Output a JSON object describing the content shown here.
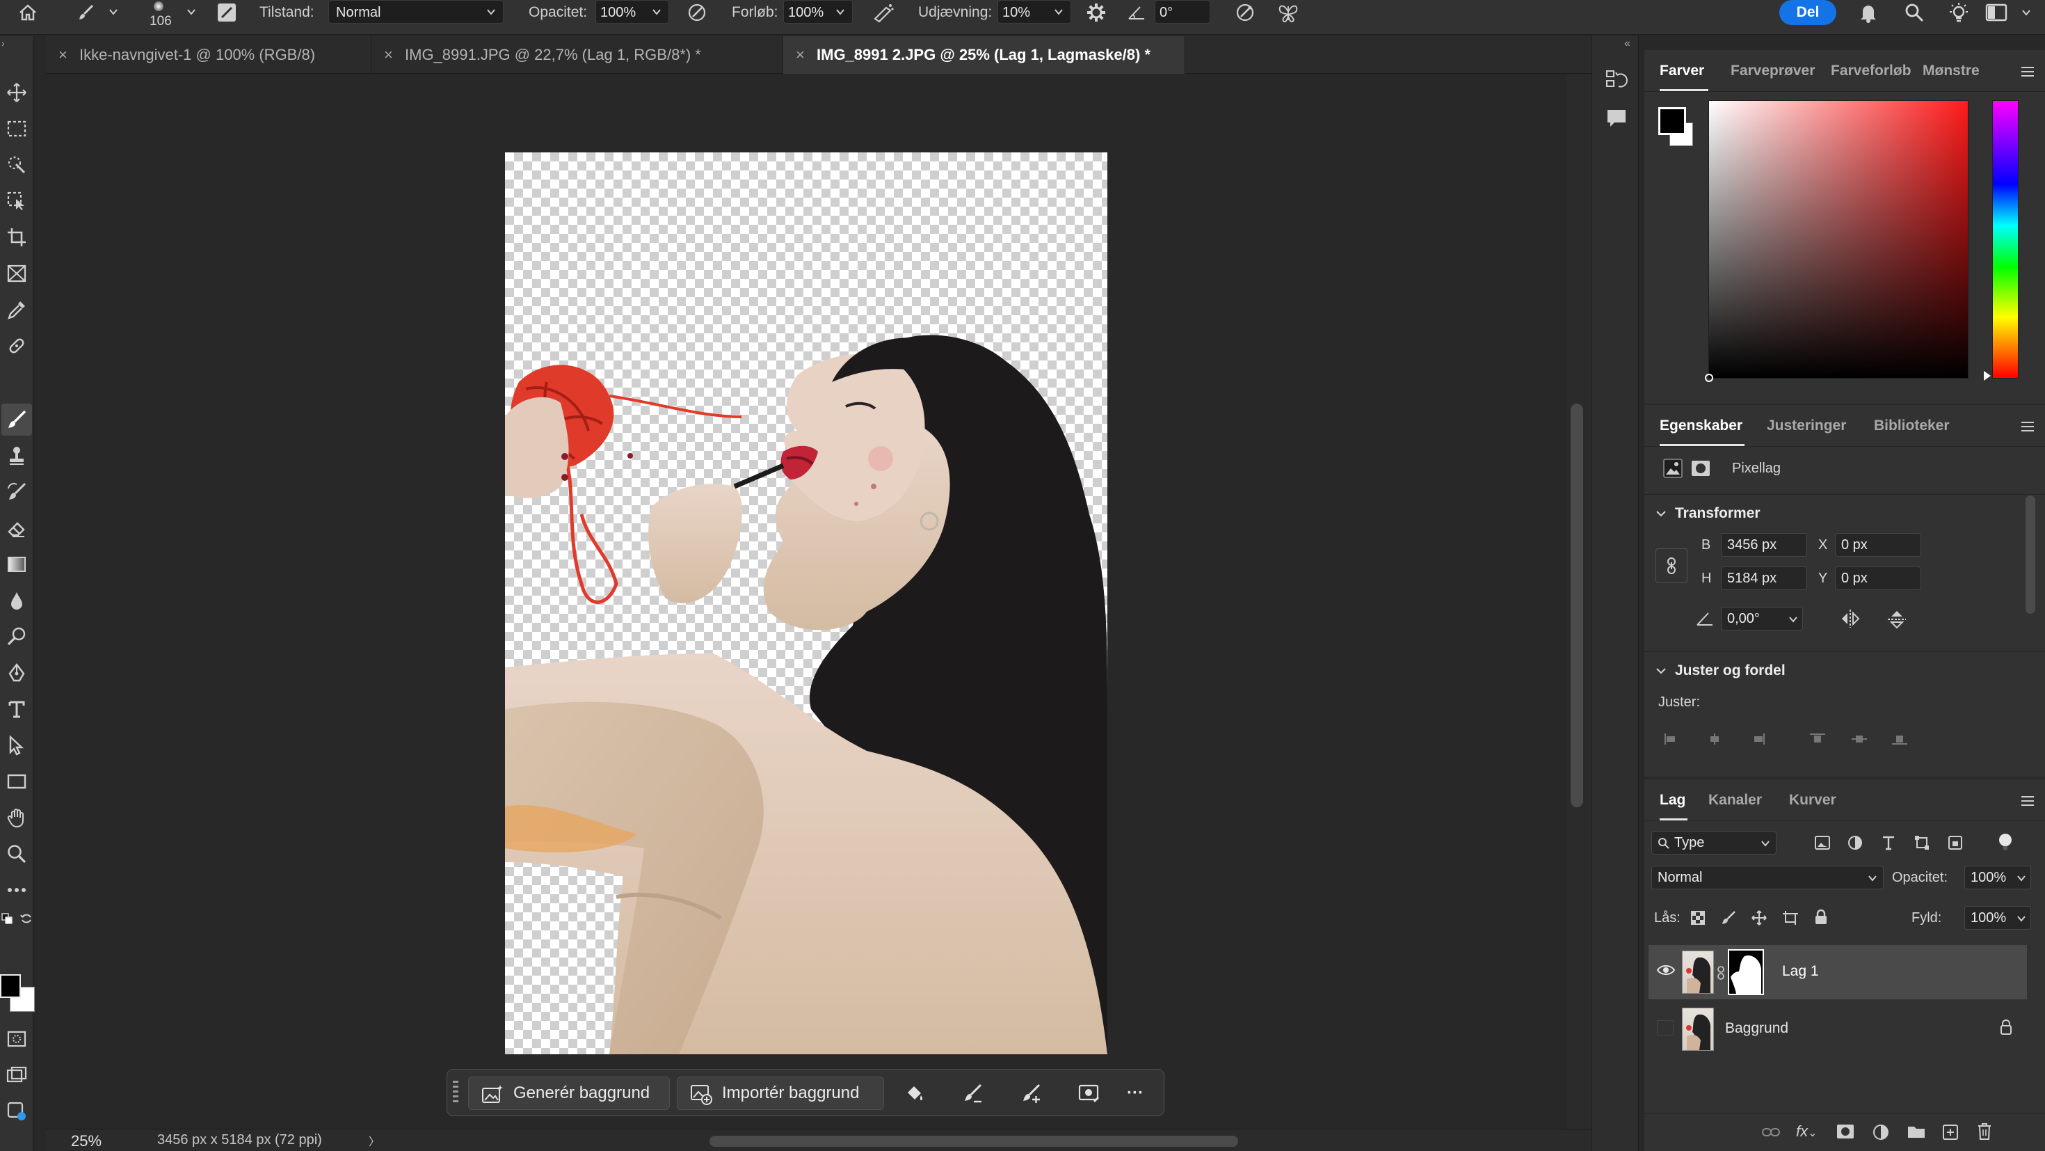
{
  "options_bar": {
    "brush_size": "106",
    "mode_label": "Tilstand:",
    "mode_value": "Normal",
    "opacity_label": "Opacitet:",
    "opacity_value": "100%",
    "flow_label": "Forløb:",
    "flow_value": "100%",
    "smoothing_label": "Udjævning:",
    "smoothing_value": "10%",
    "angle_value": "0°",
    "share_label": "Del"
  },
  "tabs": [
    {
      "label": "Ikke-navngivet-1 @ 100% (RGB/8)",
      "close": "×"
    },
    {
      "label": "IMG_8991.JPG @ 22,7% (Lag 1, RGB/8*) *",
      "close": "×"
    },
    {
      "label": "IMG_8991 2.JPG @ 25% (Lag 1, Lagmaske/8) *",
      "close": "×"
    }
  ],
  "contextual_taskbar": {
    "generate_bg": "Generér baggrund",
    "import_bg": "Importér baggrund",
    "more": "···"
  },
  "status_bar": {
    "zoom": "25%",
    "doc_info": "3456 px x 5184 px (72 ppi)",
    "arrow": "〉"
  },
  "color_panel": {
    "tabs": [
      "Farver",
      "Farveprøver",
      "Farveforløb",
      "Mønstre"
    ],
    "hue_base": "#ff1a1a"
  },
  "properties_panel": {
    "tabs": [
      "Egenskaber",
      "Justeringer",
      "Biblioteker"
    ],
    "layer_kind": "Pixellag",
    "transform_title": "Transformer",
    "w_label": "B",
    "w_value": "3456 px",
    "h_label": "H",
    "h_value": "5184 px",
    "x_label": "X",
    "x_value": "0 px",
    "y_label": "Y",
    "y_value": "0 px",
    "angle_value": "0,00°",
    "align_title": "Juster og fordel",
    "align_label": "Juster:"
  },
  "layers_panel": {
    "tabs": [
      "Lag",
      "Kanaler",
      "Kurver"
    ],
    "filter_label": "Type",
    "blend_mode": "Normal",
    "opacity_label": "Opacitet:",
    "opacity_value": "100%",
    "lock_label": "Lås:",
    "fill_label": "Fyld:",
    "fill_value": "100%",
    "layers": [
      {
        "name": "Lag 1"
      },
      {
        "name": "Baggrund"
      }
    ]
  },
  "colors": {
    "accent": "#1473e6",
    "panel_bg": "#323232",
    "selected_layer": "#4a4a4a"
  }
}
